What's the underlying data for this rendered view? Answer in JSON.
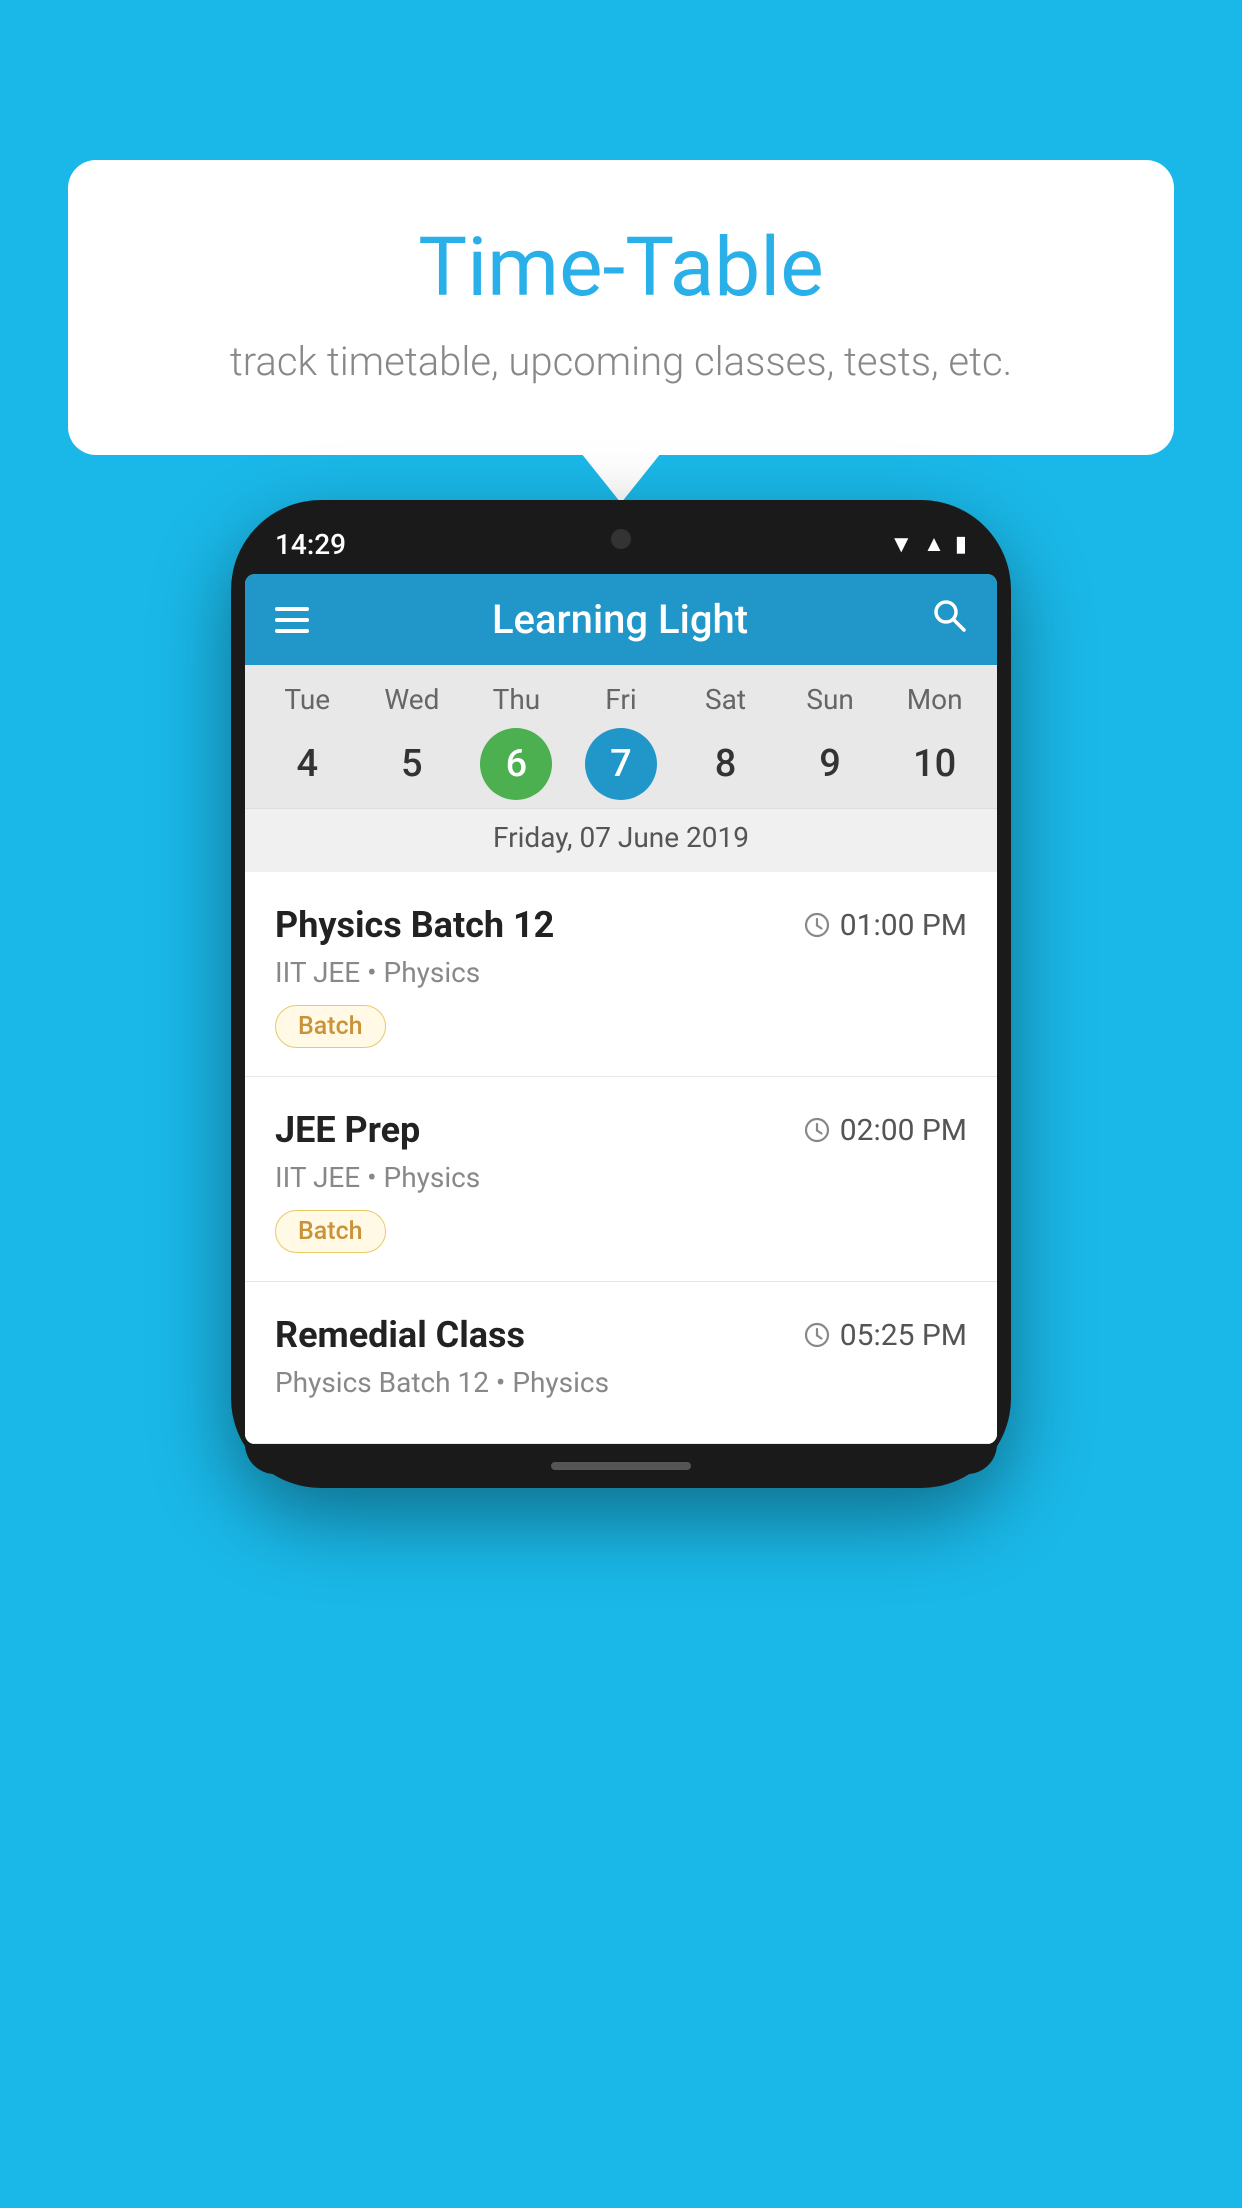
{
  "background_color": "#1ab8e8",
  "speech_bubble": {
    "title": "Time-Table",
    "subtitle": "track timetable, upcoming classes, tests, etc."
  },
  "phone": {
    "status_bar": {
      "time": "14:29"
    },
    "app_header": {
      "title": "Learning Light"
    },
    "calendar": {
      "days": [
        {
          "name": "Tue",
          "num": "4",
          "state": "normal"
        },
        {
          "name": "Wed",
          "num": "5",
          "state": "normal"
        },
        {
          "name": "Thu",
          "num": "6",
          "state": "today"
        },
        {
          "name": "Fri",
          "num": "7",
          "state": "selected"
        },
        {
          "name": "Sat",
          "num": "8",
          "state": "normal"
        },
        {
          "name": "Sun",
          "num": "9",
          "state": "normal"
        },
        {
          "name": "Mon",
          "num": "10",
          "state": "normal"
        }
      ],
      "selected_date_label": "Friday, 07 June 2019"
    },
    "schedule_items": [
      {
        "title": "Physics Batch 12",
        "time": "01:00 PM",
        "subtitle": "IIT JEE • Physics",
        "tag": "Batch"
      },
      {
        "title": "JEE Prep",
        "time": "02:00 PM",
        "subtitle": "IIT JEE • Physics",
        "tag": "Batch"
      },
      {
        "title": "Remedial Class",
        "time": "05:25 PM",
        "subtitle": "Physics Batch 12 • Physics",
        "tag": null
      }
    ]
  }
}
